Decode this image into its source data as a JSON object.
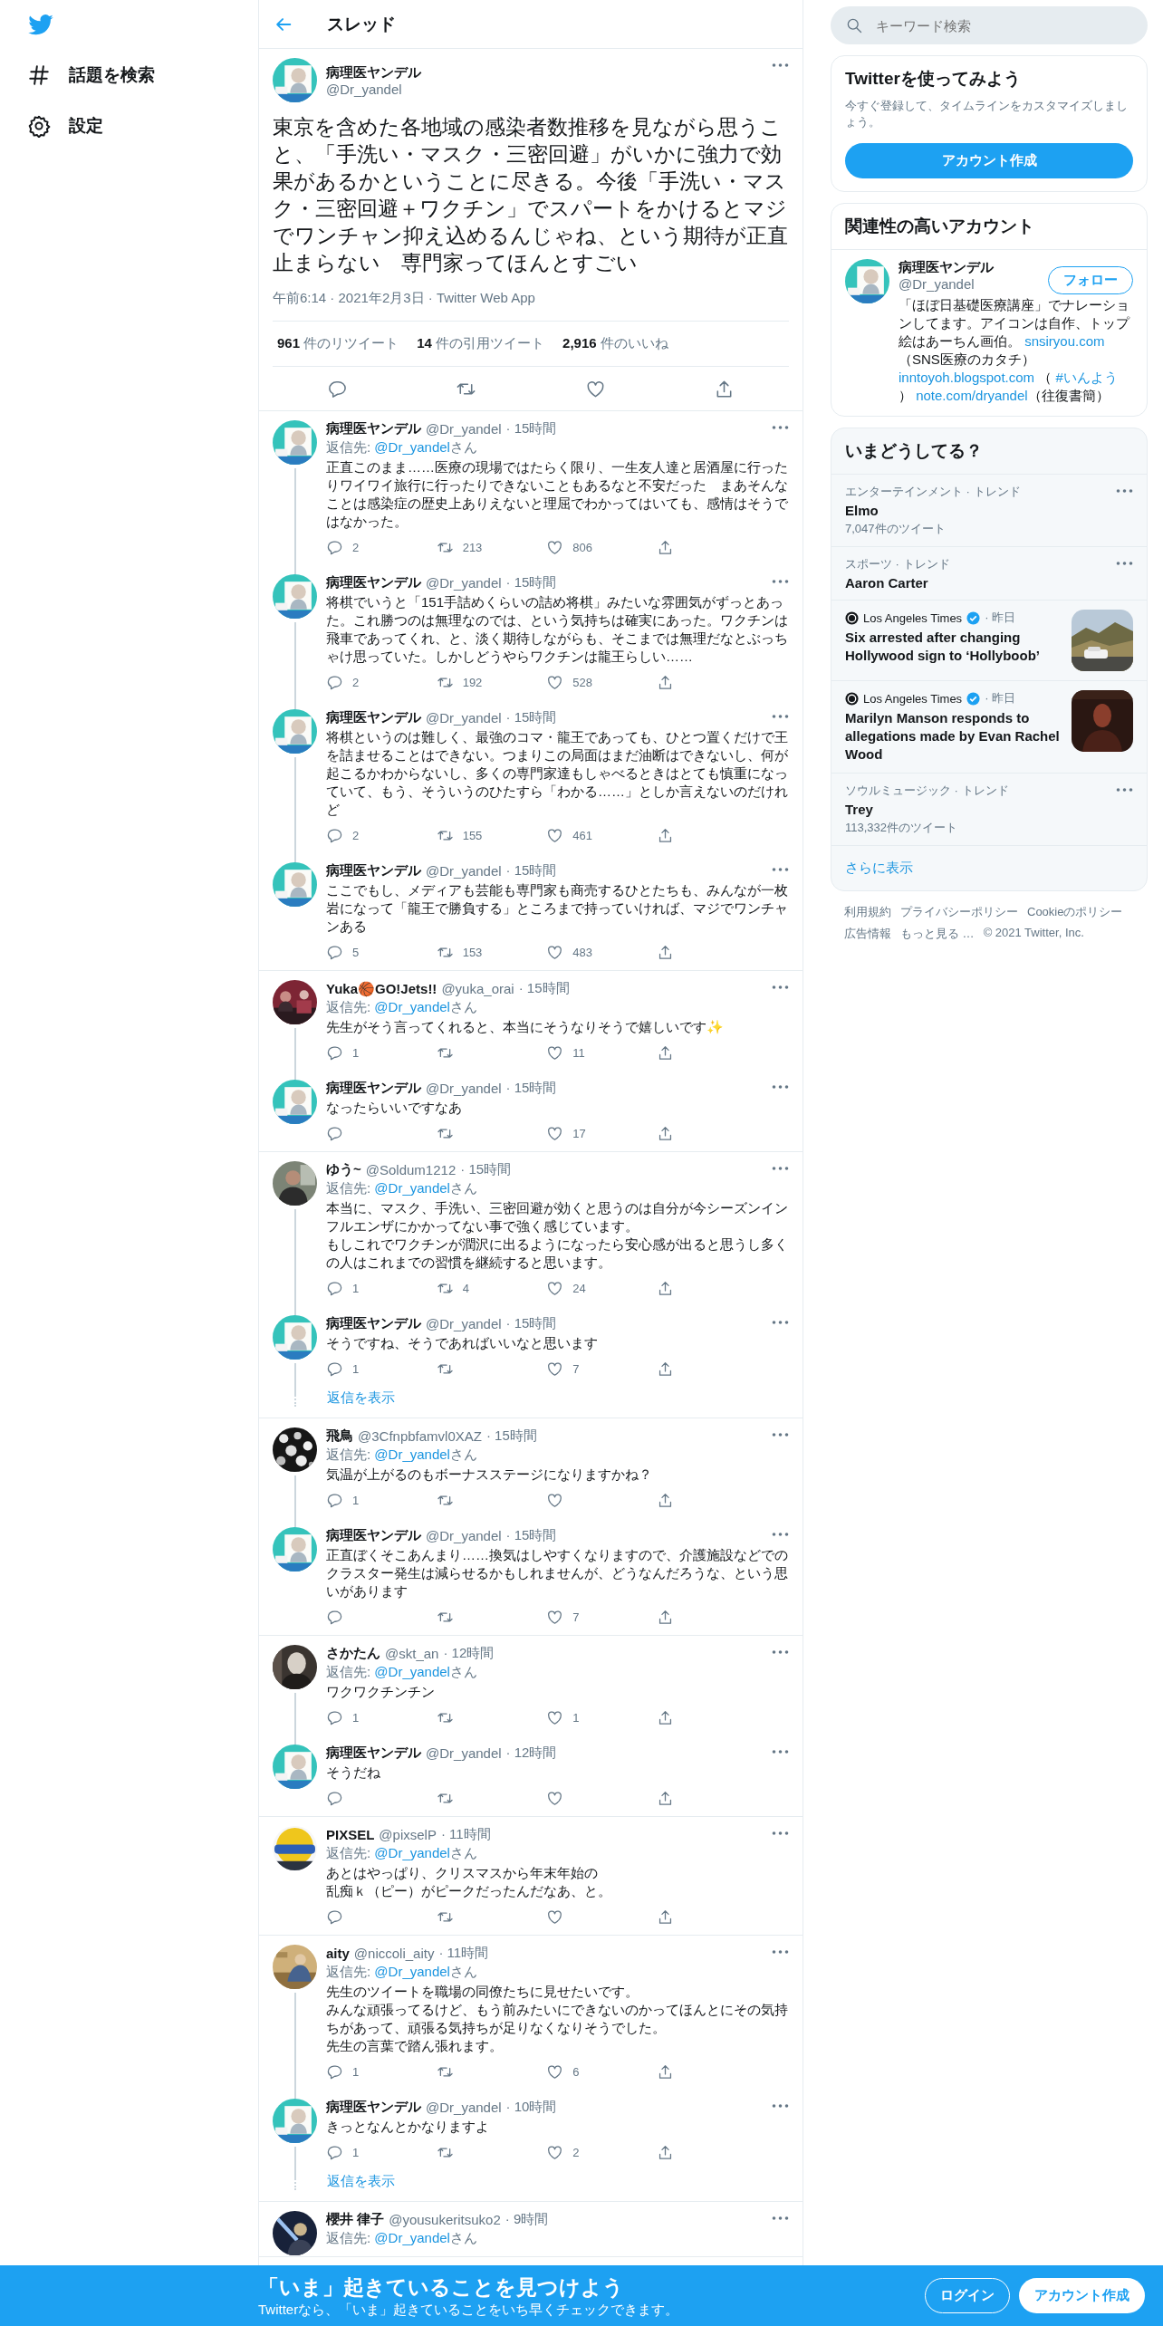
{
  "nav": {
    "items": [
      {
        "label": "話題を検索"
      },
      {
        "label": "設定"
      }
    ]
  },
  "header": {
    "title": "スレッド"
  },
  "main_tweet": {
    "name": "病理医ヤンデル",
    "handle": "@Dr_yandel",
    "text": "東京を含めた各地域の感染者数推移を見ながら思うこと、「手洗い・マスク・三密回避」がいかに強力で効果があるかということに尽きる。今後「手洗い・マスク・三密回避＋ワクチン」でスパートをかけるとマジでワンチャン抑え込めるんじゃね、という期待が正直止まらない　専門家ってほんとすごい",
    "meta": "午前6:14 · 2021年2月3日 · Twitter Web App",
    "stats": [
      {
        "count": "961",
        "label": "件のリツイート"
      },
      {
        "count": "14",
        "label": "件の引用ツイート"
      },
      {
        "count": "2,916",
        "label": "件のいいね"
      }
    ]
  },
  "threads": [
    {
      "tweets": [
        {
          "name": "病理医ヤンデル",
          "handle": "@Dr_yandel",
          "time": "· 15時間",
          "reply_to": {
            "prefix": "返信先: ",
            "mention": "@Dr_yandel",
            "suffix": "さん"
          },
          "lines": [
            "正直このまま……医療の現場ではたらく限り、一生友人達と居酒屋に行ったりワイワイ旅行に行ったりできないこともあるなと不安だった　まあそんなことは感染症の歴史上ありえないと理屈でわかってはいても、感情はそうではなかった。"
          ],
          "replies": "2",
          "retweets": "213",
          "likes": "806"
        },
        {
          "name": "病理医ヤンデル",
          "handle": "@Dr_yandel",
          "time": "· 15時間",
          "lines": [
            "将棋でいうと「151手詰めくらいの詰め将棋」みたいな雰囲気がずっとあった。これ勝つのは無理なのでは、という気持ちは確実にあった。ワクチンは飛車であってくれ、と、淡く期待しながらも、そこまでは無理だなとぶっちゃけ思っていた。しかしどうやらワクチンは龍王らしい……"
          ],
          "replies": "2",
          "retweets": "192",
          "likes": "528"
        },
        {
          "name": "病理医ヤンデル",
          "handle": "@Dr_yandel",
          "time": "· 15時間",
          "lines": [
            "将棋というのは難しく、最強のコマ・龍王であっても、ひとつ置くだけで王を詰ませることはできない。つまりこの局面はまだ油断はできないし、何が起こるかわからないし、多くの専門家達もしゃべるときはとても慎重になっていて、もう、そういうのひたすら「わかる……」としか言えないのだけれど"
          ],
          "replies": "2",
          "retweets": "155",
          "likes": "461"
        },
        {
          "name": "病理医ヤンデル",
          "handle": "@Dr_yandel",
          "time": "· 15時間",
          "lines": [
            "ここでもし、メディアも芸能も専門家も商売するひとたちも、みんなが一枚岩になって「龍王で勝負する」ところまで持っていければ、マジでワンチャンある"
          ],
          "replies": "5",
          "retweets": "153",
          "likes": "483"
        }
      ]
    },
    {
      "tweets": [
        {
          "name": "Yuka🏀GO!Jets!!",
          "handle": "@yuka_orai",
          "time": "· 15時間",
          "reply_to": {
            "prefix": "返信先: ",
            "mention": "@Dr_yandel",
            "suffix": "さん"
          },
          "lines": [
            "先生がそう言ってくれると、本当にそうなりそうで嬉しいです✨"
          ],
          "replies": "1",
          "likes": "11"
        },
        {
          "name": "病理医ヤンデル",
          "handle": "@Dr_yandel",
          "time": "· 15時間",
          "lines": [
            "なったらいいですなあ"
          ],
          "likes": "17"
        }
      ]
    },
    {
      "tweets": [
        {
          "name": "ゆう~",
          "handle": "@Soldum1212",
          "time": "· 15時間",
          "reply_to": {
            "prefix": "返信先: ",
            "mention": "@Dr_yandel",
            "suffix": "さん"
          },
          "lines": [
            "本当に、マスク、手洗い、三密回避が効くと思うのは自分が今シーズンインフルエンザにかかってない事で強く感じています。",
            "もしこれでワクチンが潤沢に出るようになったら安心感が出ると思うし多くの人はこれまでの習慣を継続すると思います。"
          ],
          "replies": "1",
          "retweets": "4",
          "likes": "24"
        },
        {
          "name": "病理医ヤンデル",
          "handle": "@Dr_yandel",
          "time": "· 15時間",
          "lines": [
            "そうですね、そうであればいいなと思います"
          ],
          "replies": "1",
          "likes": "7"
        }
      ],
      "more_link": "返信を表示"
    },
    {
      "tweets": [
        {
          "name": "飛鳥",
          "handle": "@3Cfnpbfamvl0XAZ",
          "time": "· 15時間",
          "reply_to": {
            "prefix": "返信先: ",
            "mention": "@Dr_yandel",
            "suffix": "さん"
          },
          "lines": [
            "気温が上がるのもボーナスステージになりますかね？"
          ],
          "replies": "1"
        },
        {
          "name": "病理医ヤンデル",
          "handle": "@Dr_yandel",
          "time": "· 15時間",
          "lines": [
            "正直ぼくそこあんまり……換気はしやすくなりますので、介護施設などでのクラスター発生は減らせるかもしれませんが、どうなんだろうな、という思いがあります"
          ],
          "likes": "7"
        }
      ]
    },
    {
      "tweets": [
        {
          "name": "さかたん",
          "handle": "@skt_an",
          "time": "· 12時間",
          "reply_to": {
            "prefix": "返信先: ",
            "mention": "@Dr_yandel",
            "suffix": "さん"
          },
          "lines": [
            "ワクワクチンチン"
          ],
          "replies": "1",
          "likes": "1"
        },
        {
          "name": "病理医ヤンデル",
          "handle": "@Dr_yandel",
          "time": "· 12時間",
          "lines": [
            "そうだね"
          ]
        }
      ]
    },
    {
      "tweets": [
        {
          "name": "PIXSEL",
          "handle": "@pixselP",
          "time": "· 11時間",
          "reply_to": {
            "prefix": "返信先: ",
            "mention": "@Dr_yandel",
            "suffix": "さん"
          },
          "lines": [
            "あとはやっぱり、クリスマスから年末年始の",
            "乱痴ｋ（ピー）がピークだったんだなあ、と。"
          ]
        }
      ]
    },
    {
      "tweets": [
        {
          "name": "aity",
          "handle": "@niccoli_aity",
          "time": "· 11時間",
          "reply_to": {
            "prefix": "返信先: ",
            "mention": "@Dr_yandel",
            "suffix": "さん"
          },
          "lines": [
            "先生のツイートを職場の同僚たちに見せたいです。",
            "みんな頑張ってるけど、もう前みたいにできないのかってほんとにその気持ちがあって、頑張る気持ちが足りなくなりそうでした。",
            "先生の言葉で踏ん張れます。"
          ],
          "replies": "1",
          "likes": "6"
        },
        {
          "name": "病理医ヤンデル",
          "handle": "@Dr_yandel",
          "time": "· 10時間",
          "lines": [
            "きっとなんとかなりますよ"
          ],
          "replies": "1",
          "likes": "2"
        }
      ],
      "more_link": "返信を表示"
    },
    {
      "tweets": [
        {
          "name": "櫻井 律子",
          "handle": "@yousukeritsuko2",
          "time": "· 9時間",
          "reply_to": {
            "prefix": "返信先: ",
            "mention": "@Dr_yandel",
            "suffix": "さん"
          }
        }
      ]
    }
  ],
  "search": {
    "placeholder": "キーワード検索"
  },
  "signup_card": {
    "title": "Twitterを使ってみよう",
    "text": "今すぐ登録して、タイムラインをカスタマイズしましょう。",
    "button": "アカウント作成"
  },
  "related": {
    "title": "関連性の高いアカウント",
    "name": "病理医ヤンデル",
    "handle": "@Dr_yandel",
    "follow": "フォロー",
    "bio": [
      {
        "kind": "text",
        "text": "「ほぼ日基礎医療講座」でナレーションしてます。アイコンは自作、トップ絵はあーちん画伯。 "
      },
      {
        "kind": "link",
        "text": "snsiryou.com"
      },
      {
        "kind": "text",
        "text": " （SNS医療のカタチ） "
      },
      {
        "kind": "link",
        "text": "inntoyoh.blogspot.com"
      },
      {
        "kind": "text",
        "text": " （ "
      },
      {
        "kind": "link",
        "text": "#いんよう"
      },
      {
        "kind": "text",
        "text": " ） "
      },
      {
        "kind": "link",
        "text": "note.com/dryandel"
      },
      {
        "kind": "text",
        "text": "（往復書簡）"
      }
    ]
  },
  "trends": {
    "title": "いまどうしてる？",
    "items": [
      {
        "kind": "trend",
        "category": "エンターテインメント · トレンド",
        "title": "Elmo",
        "count": "7,047件のツイート"
      },
      {
        "kind": "trend",
        "category": "スポーツ · トレンド",
        "title": "Aaron Carter"
      },
      {
        "kind": "news",
        "source": "Los Angeles Times",
        "verified": true,
        "time": "· 昨日",
        "title": "Six arrested after changing Hollywood sign to ‘Hollyboob’"
      },
      {
        "kind": "news",
        "source": "Los Angeles Times",
        "verified": true,
        "time": "· 昨日",
        "title": "Marilyn Manson responds to allegations made by Evan Rachel Wood"
      },
      {
        "kind": "trend",
        "category": "ソウルミュージック · トレンド",
        "title": "Trey",
        "count": "113,332件のツイート"
      }
    ],
    "more": "さらに表示"
  },
  "footer": [
    "利用規約",
    "プライバシーポリシー",
    "Cookieのポリシー",
    "広告情報",
    "もっと見る …",
    "© 2021 Twitter, Inc."
  ],
  "banner": {
    "title": "「いま」起きていることを見つけよう",
    "text": "Twitterなら、「いま」起きていることをいち早くチェックできます。",
    "login": "ログイン",
    "signup": "アカウント作成"
  }
}
